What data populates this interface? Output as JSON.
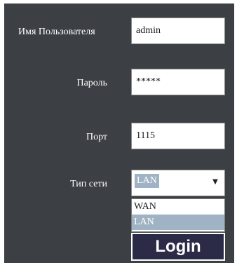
{
  "form": {
    "username": {
      "label": "Имя Пользователя",
      "value": "admin"
    },
    "password": {
      "label": "Пароль",
      "value": "*****"
    },
    "port": {
      "label": "Порт",
      "value": "1115"
    },
    "network_type": {
      "label": "Тип сети",
      "selected": "LAN",
      "options": [
        "WAN",
        "LAN"
      ]
    },
    "login_label": "Login"
  },
  "colors": {
    "panel_bg": "#3c3f44",
    "selection_bg": "#9fb3c4",
    "button_bg": "#2c2b47"
  },
  "icons": {
    "select_arrow": "chevron-down-icon"
  }
}
